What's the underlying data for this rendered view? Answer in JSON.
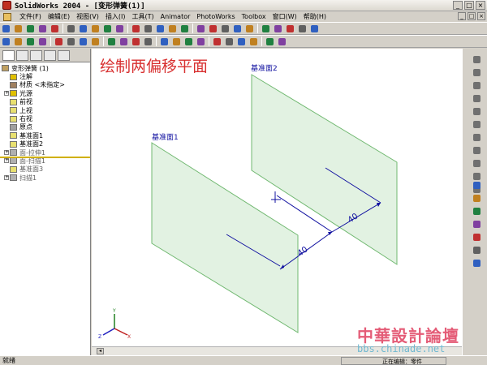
{
  "window": {
    "title": "SolidWorks 2004 - [变形弹簧(1)]",
    "controls": [
      "_",
      "□",
      "×"
    ]
  },
  "menu": {
    "items": [
      "文件(F)",
      "编辑(E)",
      "视图(V)",
      "插入(I)",
      "工具(T)",
      "Animator",
      "PhotoWorks",
      "Toolbox",
      "窗口(W)",
      "帮助(H)"
    ],
    "mdi_controls": [
      "_",
      "□",
      "×"
    ]
  },
  "tree": {
    "items": [
      {
        "label": "变形弹簧 (1)",
        "icon": "part-icon",
        "expander": ""
      },
      {
        "label": "注解",
        "icon": "annotation-icon",
        "expander": ""
      },
      {
        "label": "材质 <未指定>",
        "icon": "material-icon",
        "expander": ""
      },
      {
        "label": "光源",
        "icon": "lights-icon",
        "expander": "+"
      },
      {
        "label": "前视",
        "icon": "plane-icon",
        "expander": ""
      },
      {
        "label": "上视",
        "icon": "plane-icon",
        "expander": ""
      },
      {
        "label": "右视",
        "icon": "plane-icon",
        "expander": ""
      },
      {
        "label": "原点",
        "icon": "origin-icon",
        "expander": ""
      },
      {
        "label": "基准面1",
        "icon": "plane-icon",
        "expander": ""
      },
      {
        "label": "基准面2",
        "icon": "plane-icon",
        "expander": ""
      },
      {
        "label": "面-拉伸1",
        "icon": "extrude-icon",
        "expander": "+"
      },
      {
        "label": "面-扫描1",
        "icon": "sweep-icon",
        "expander": "+"
      },
      {
        "label": "基准面3",
        "icon": "plane-icon",
        "expander": ""
      },
      {
        "label": "扫描1",
        "icon": "sweep-icon",
        "expander": "+"
      }
    ]
  },
  "canvas": {
    "heading": "绘制两偏移平面",
    "plane1_label": "基准面1",
    "plane2_label": "基准面2",
    "dim1": "40",
    "dim2": "40",
    "plane_fill": "#d8eed8",
    "plane_stroke": "#70b870",
    "heading_color": "#d83030",
    "dimension_color": "#1010a0"
  },
  "status": {
    "left": "就绪",
    "right": "正在编辑：零件"
  },
  "watermark": {
    "logo": "中華設計論壇",
    "url": "bbs.chinade.net"
  },
  "toolbar": {
    "row1_icons": [
      "new-icon",
      "open-icon",
      "save-icon",
      "print-icon",
      "preview-icon",
      "cut-icon",
      "copy-icon",
      "paste-icon",
      "undo-icon",
      "redo-icon",
      "select-icon",
      "rebuild-icon",
      "options-icon",
      "help-icon",
      "zoom-fit-icon",
      "zoom-area-icon",
      "zoom-icon",
      "rotate-icon",
      "pan-icon",
      "view-orient-icon",
      "wireframe-icon",
      "hidden-icon",
      "shaded-icon",
      "perspective-icon",
      "section-icon"
    ],
    "row2_icons": [
      "sketch-icon",
      "line-icon",
      "circle-icon",
      "arc-icon",
      "spline-icon",
      "dimension-icon",
      "relation-icon",
      "extrude-icon",
      "revolve-icon",
      "sweep-icon",
      "loft-icon",
      "fillet-icon",
      "chamfer-icon",
      "shell-icon",
      "rib-icon",
      "draft-icon",
      "hole-icon",
      "pattern-icon",
      "mirror-icon",
      "plane-icon",
      "axis-icon",
      "point-icon"
    ]
  }
}
